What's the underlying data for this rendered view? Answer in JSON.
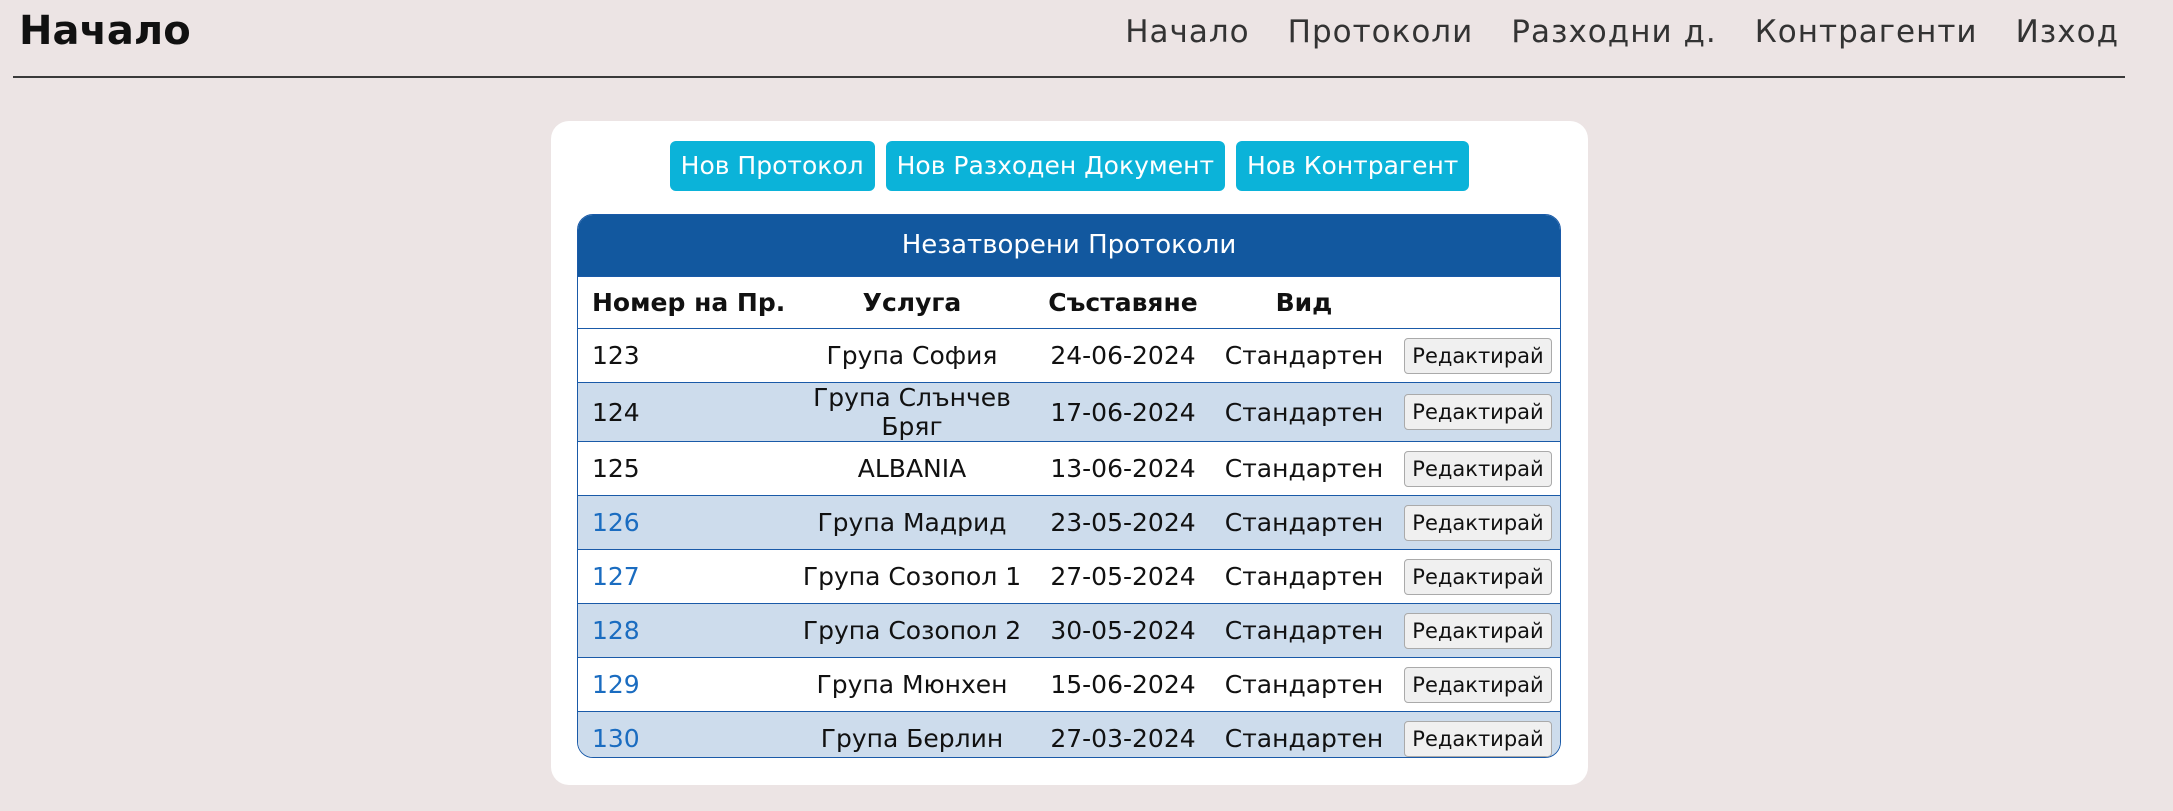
{
  "header": {
    "brand": "Начало",
    "nav": [
      "Начало",
      "Протоколи",
      "Разходни д.",
      "Контрагенти",
      "Изход"
    ]
  },
  "actions": [
    "Нов Протокол",
    "Нов Разходен Документ",
    "Нов Контрагент"
  ],
  "table": {
    "title": "Незатворени Протоколи",
    "columns": [
      "Номер на Пр.",
      "Услуга",
      "Съставяне",
      "Вид",
      ""
    ],
    "edit_label": "Редактирай",
    "rows": [
      {
        "number": "123",
        "service": "Група София",
        "date": "24-06-2024",
        "type": "Стандартен",
        "linked": false
      },
      {
        "number": "124",
        "service": "Група Слънчев Бряг",
        "date": "17-06-2024",
        "type": "Стандартен",
        "linked": false
      },
      {
        "number": "125",
        "service": "ALBANIA",
        "date": "13-06-2024",
        "type": "Стандартен",
        "linked": false
      },
      {
        "number": "126",
        "service": "Група Мадрид",
        "date": "23-05-2024",
        "type": "Стандартен",
        "linked": true
      },
      {
        "number": "127",
        "service": "Група Созопол 1",
        "date": "27-05-2024",
        "type": "Стандартен",
        "linked": true
      },
      {
        "number": "128",
        "service": "Група Созопол 2",
        "date": "30-05-2024",
        "type": "Стандартен",
        "linked": true
      },
      {
        "number": "129",
        "service": "Група Мюнхен",
        "date": "15-06-2024",
        "type": "Стандартен",
        "linked": true
      },
      {
        "number": "130",
        "service": "Група Берлин",
        "date": "27-03-2024",
        "type": "Стандартен",
        "linked": true
      }
    ]
  },
  "colors": {
    "background": "#ece4e4",
    "header_blue": "#12589f",
    "button_cyan": "#0bb3d9",
    "row_alt": "#cddcec",
    "link_blue": "#1a6cc0"
  }
}
